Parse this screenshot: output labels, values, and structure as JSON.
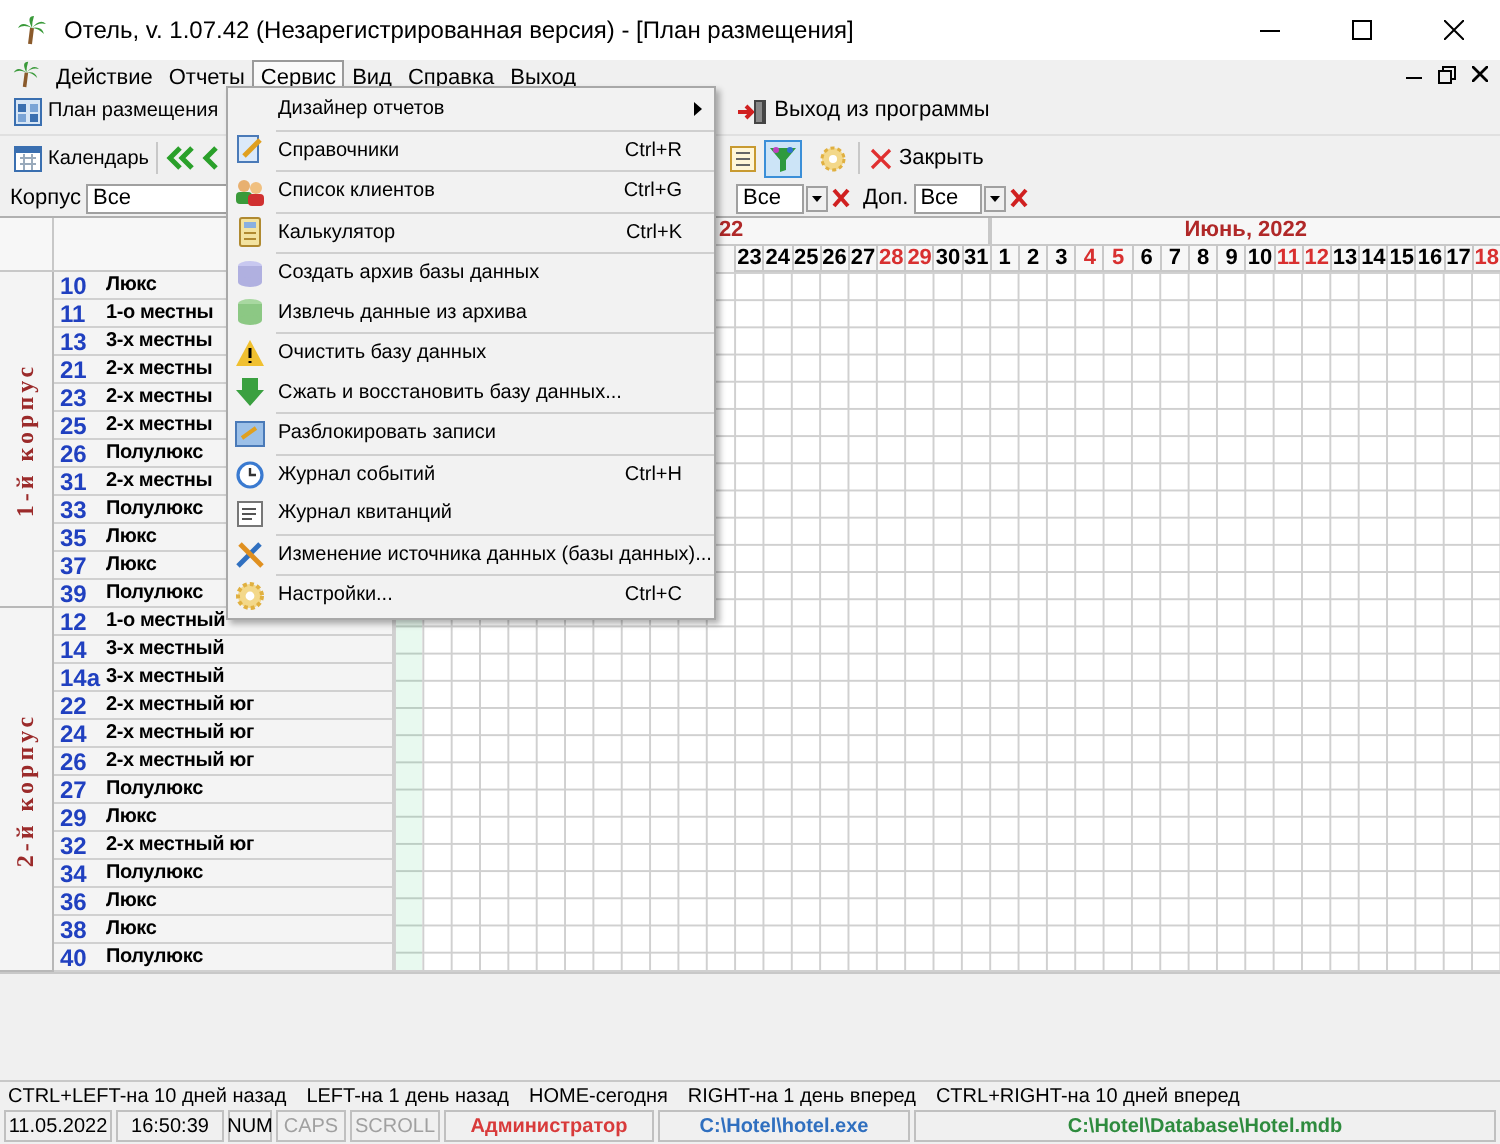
{
  "window": {
    "title": "Отель, v. 1.07.42 (Незарегистрированная версия) - [План размещения]"
  },
  "menu_bar": [
    {
      "label": "Действие",
      "selected": false
    },
    {
      "label": "Отчеты",
      "selected": false
    },
    {
      "label": "Сервис",
      "selected": true
    },
    {
      "label": "Вид",
      "selected": false
    },
    {
      "label": "Справка",
      "selected": false
    },
    {
      "label": "Выход",
      "selected": false
    }
  ],
  "toolbar_top": {
    "plan_button": "План размещения",
    "exit_button": "Выход из программы"
  },
  "toolbar_second": {
    "calendar_button": "Календарь",
    "filter_pressed": true,
    "close_button": "Закрыть"
  },
  "filters": {
    "building_label": "Корпус",
    "building_value": "Все",
    "filter_value": "Все",
    "extra_label": "Доп.",
    "extra_value": "Все"
  },
  "calendar": {
    "months": [
      {
        "label": "22",
        "days": [
          {
            "label": "23",
            "weekend": false
          },
          {
            "label": "24",
            "weekend": false
          },
          {
            "label": "25",
            "weekend": false
          },
          {
            "label": "26",
            "weekend": false
          },
          {
            "label": "27",
            "weekend": false
          },
          {
            "label": "28",
            "weekend": true
          },
          {
            "label": "29",
            "weekend": true
          },
          {
            "label": "30",
            "weekend": false
          },
          {
            "label": "31",
            "weekend": false
          }
        ]
      },
      {
        "label": "Июнь, 2022",
        "days": [
          {
            "label": "1",
            "weekend": false
          },
          {
            "label": "2",
            "weekend": false
          },
          {
            "label": "3",
            "weekend": false
          },
          {
            "label": "4",
            "weekend": true
          },
          {
            "label": "5",
            "weekend": true
          },
          {
            "label": "6",
            "weekend": false
          },
          {
            "label": "7",
            "weekend": false
          },
          {
            "label": "8",
            "weekend": false
          },
          {
            "label": "9",
            "weekend": false
          },
          {
            "label": "10",
            "weekend": false
          },
          {
            "label": "11",
            "weekend": true
          },
          {
            "label": "12",
            "weekend": true
          },
          {
            "label": "13",
            "weekend": false
          },
          {
            "label": "14",
            "weekend": false
          },
          {
            "label": "15",
            "weekend": false
          },
          {
            "label": "16",
            "weekend": false
          },
          {
            "label": "17",
            "weekend": false
          },
          {
            "label": "18",
            "weekend": true
          }
        ]
      }
    ]
  },
  "groups": [
    {
      "label": "1-й корпус",
      "rooms": [
        {
          "number": "10",
          "type": "Люкс"
        },
        {
          "number": "11",
          "type": "1-о местны"
        },
        {
          "number": "13",
          "type": "3-х местны"
        },
        {
          "number": "21",
          "type": "2-х местны"
        },
        {
          "number": "23",
          "type": "2-х местны"
        },
        {
          "number": "25",
          "type": "2-х местны"
        },
        {
          "number": "26",
          "type": "Полулюкс"
        },
        {
          "number": "31",
          "type": "2-х местны"
        },
        {
          "number": "33",
          "type": "Полулюкс"
        },
        {
          "number": "35",
          "type": "Люкс"
        },
        {
          "number": "37",
          "type": "Люкс"
        },
        {
          "number": "39",
          "type": "Полулюкс"
        }
      ]
    },
    {
      "label": "2-й корпус",
      "rooms": [
        {
          "number": "12",
          "type": "1-о местный"
        },
        {
          "number": "14",
          "type": "3-х местный"
        },
        {
          "number": "14а",
          "type": "3-х местный"
        },
        {
          "number": "22",
          "type": "2-х местный юг"
        },
        {
          "number": "24",
          "type": "2-х местный юг"
        },
        {
          "number": "26",
          "type": "2-х местный юг"
        },
        {
          "number": "27",
          "type": "Полулюкс"
        },
        {
          "number": "29",
          "type": "Люкс"
        },
        {
          "number": "32",
          "type": "2-х местный юг"
        },
        {
          "number": "34",
          "type": "Полулюкс"
        },
        {
          "number": "36",
          "type": "Люкс"
        },
        {
          "number": "38",
          "type": "Люкс"
        },
        {
          "number": "40",
          "type": "Полулюкс"
        }
      ]
    }
  ],
  "service_menu": [
    {
      "label": "Дизайнер отчетов",
      "submenu": true,
      "separator": true
    },
    {
      "label": "Справочники",
      "shortcut": "Ctrl+R",
      "submenu": false,
      "separator": true
    },
    {
      "label": "Список клиентов",
      "shortcut": "Ctrl+G",
      "submenu": false,
      "separator": true
    },
    {
      "label": "Калькулятор",
      "shortcut": "Ctrl+K",
      "submenu": false,
      "separator": true
    },
    {
      "label": "Создать архив базы данных",
      "submenu": false,
      "separator": false
    },
    {
      "label": "Извлечь данные из архива",
      "submenu": false,
      "separator": true
    },
    {
      "label": "Очистить базу данных",
      "submenu": false,
      "separator": false
    },
    {
      "label": "Сжать и восстановить базу данных...",
      "submenu": false,
      "separator": true
    },
    {
      "label": "Разблокировать записи",
      "submenu": false,
      "separator": true
    },
    {
      "label": "Журнал событий",
      "shortcut": "Ctrl+H",
      "submenu": false,
      "separator": false
    },
    {
      "label": "Журнал квитанций",
      "submenu": false,
      "separator": true
    },
    {
      "label": "Изменение источника данных (базы данных)...",
      "submenu": false,
      "separator": true
    },
    {
      "label": "Настройки...",
      "shortcut": "Ctrl+C",
      "submenu": false,
      "separator": false
    }
  ],
  "hints": [
    "CTRL+LEFT-на 10 дней назад",
    "LEFT-на 1 день назад",
    "HOME-сегодня",
    "RIGHT-на 1 день вперед",
    "CTRL+RIGHT-на 10 дней вперед"
  ],
  "status_bar": [
    {
      "text": "11.05.2022",
      "color": "#000000"
    },
    {
      "text": "16:50:39",
      "color": "#000000"
    },
    {
      "text": "NUM",
      "color": "#000000"
    },
    {
      "text": "CAPS",
      "color": "#a0a0a0"
    },
    {
      "text": "SCROLL",
      "color": "#a0a0a0"
    },
    {
      "text": "Администратор",
      "color": "#d83a3a"
    },
    {
      "text": "C:\\Hotel\\hotel.exe",
      "color": "#2f6fbf"
    },
    {
      "text": "C:\\Hotel\\Database\\Hotel.mdb",
      "color": "#2e8b3e"
    }
  ]
}
